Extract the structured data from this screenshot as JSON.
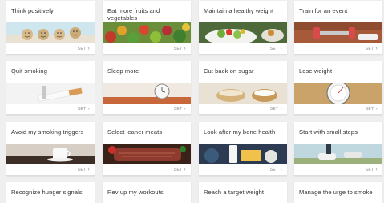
{
  "set_label": "SET",
  "cards": [
    {
      "title": "Think positively",
      "image": "smiley-faces-photo"
    },
    {
      "title": "Eat more fruits and vegetables",
      "image": "vegetables-photo"
    },
    {
      "title": "Maintain a healthy weight",
      "image": "salad-photo"
    },
    {
      "title": "Train for an event",
      "image": "dumbbells-photo"
    },
    {
      "title": "Quit smoking",
      "image": "broken-cigarette-photo"
    },
    {
      "title": "Sleep more",
      "image": "alarm-clock-photo"
    },
    {
      "title": "Cut back on sugar",
      "image": "sugar-bowls-photo"
    },
    {
      "title": "Lose weight",
      "image": "scale-photo"
    },
    {
      "title": "Avoid my smoking triggers",
      "image": "coffee-cup-photo"
    },
    {
      "title": "Select leaner meats",
      "image": "meat-photo"
    },
    {
      "title": "Look after my bone health",
      "image": "milk-cheese-photo"
    },
    {
      "title": "Start with small steps",
      "image": "running-feet-photo"
    },
    {
      "title": "Recognize hunger signals",
      "image": ""
    },
    {
      "title": "Rev up my workouts",
      "image": ""
    },
    {
      "title": "Reach a target weight",
      "image": ""
    },
    {
      "title": "Manage the urge to smoke",
      "image": ""
    }
  ]
}
